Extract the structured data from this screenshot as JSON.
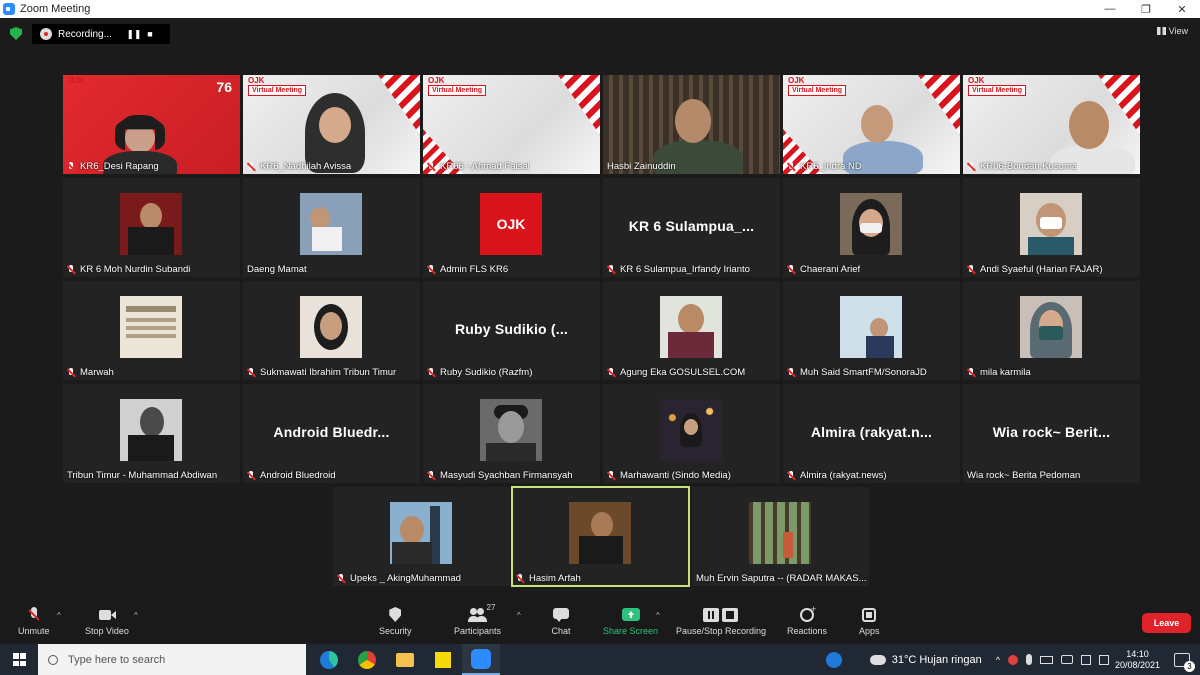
{
  "window": {
    "title": "Zoom Meeting",
    "minimize": "—",
    "maximize": "❐",
    "close": "✕"
  },
  "recording": {
    "label": "Recording...",
    "pause": "❚❚",
    "stop": "■"
  },
  "view": {
    "label": "View"
  },
  "participants": [
    {
      "name": "KR6_Desi Rapang",
      "muted": true,
      "bg": "red"
    },
    {
      "name": "KR6_Nadhilah Avissa",
      "muted": true,
      "bg": "virtual"
    },
    {
      "name": "KR06 - Ahmad Faisal",
      "muted": true,
      "bg": "virtual"
    },
    {
      "name": "Hasbi Zainuddin",
      "muted": false,
      "bg": "photo"
    },
    {
      "name": "KR6_Indra ND",
      "muted": true,
      "bg": "virtual"
    },
    {
      "name": "KR06-Bondan.Kusuma",
      "muted": true,
      "bg": "virtual"
    },
    {
      "name": "KR 6 Moh Nurdin Subandi",
      "muted": true
    },
    {
      "name": "Daeng Mamat",
      "muted": false
    },
    {
      "name": "Admin FLS KR6",
      "muted": true
    },
    {
      "name": "KR 6 Sulampua_Irfandy Irianto",
      "muted": true,
      "display": "KR 6 Sulampua_..."
    },
    {
      "name": "Chaerani Arief",
      "muted": true
    },
    {
      "name": "Andi Syaeful (Harian FAJAR)",
      "muted": true
    },
    {
      "name": "Marwah",
      "muted": true
    },
    {
      "name": "Sukmawati Ibrahim Tribun Timur",
      "muted": true
    },
    {
      "name": "Ruby  Sudikio (Razfm)",
      "muted": true,
      "display": "Ruby  Sudikio (..."
    },
    {
      "name": "Agung Eka GOSULSEL.COM",
      "muted": true
    },
    {
      "name": "Muh Said SmartFM/SonoraJD",
      "muted": true
    },
    {
      "name": "mila karmila",
      "muted": true
    },
    {
      "name": "Tribun Timur - Muhammad Abdiwan",
      "muted": false
    },
    {
      "name": "Android Bluedroid",
      "muted": true,
      "display": "Android  Bluedr..."
    },
    {
      "name": "Masyudi Syachban Firmansyah",
      "muted": true
    },
    {
      "name": "Marhawanti (Sindo Media)",
      "muted": true
    },
    {
      "name": "Almira (rakyat.news)",
      "muted": true,
      "display": "Almira  (rakyat.n..."
    },
    {
      "name": "Wia rock~ Berita Pedoman",
      "muted": false,
      "display": "Wia  rock~  Berit..."
    },
    {
      "name": "Upeks _ AkingMuhammad",
      "muted": true
    },
    {
      "name": "Hasim Arfah",
      "muted": true,
      "active": true
    },
    {
      "name": "Muh Ervin Saputra -- (RADAR MAKAS...",
      "muted": false
    }
  ],
  "tile_texts": {
    "virtual_meeting": "Virtual Meeting",
    "ojk": "OJK",
    "ojk_76": "76"
  },
  "controls": {
    "unmute": "Unmute",
    "stop_video": "Stop Video",
    "security": "Security",
    "participants": "Participants",
    "participants_count": "27",
    "chat": "Chat",
    "share_screen": "Share Screen",
    "pause_stop_recording": "Pause/Stop Recording",
    "reactions": "Reactions",
    "apps": "Apps",
    "leave": "Leave"
  },
  "taskbar": {
    "search_placeholder": "Type here to search",
    "weather": "31°C  Hujan ringan",
    "time": "14:10",
    "date": "20/08/2021",
    "notifications": "3"
  }
}
